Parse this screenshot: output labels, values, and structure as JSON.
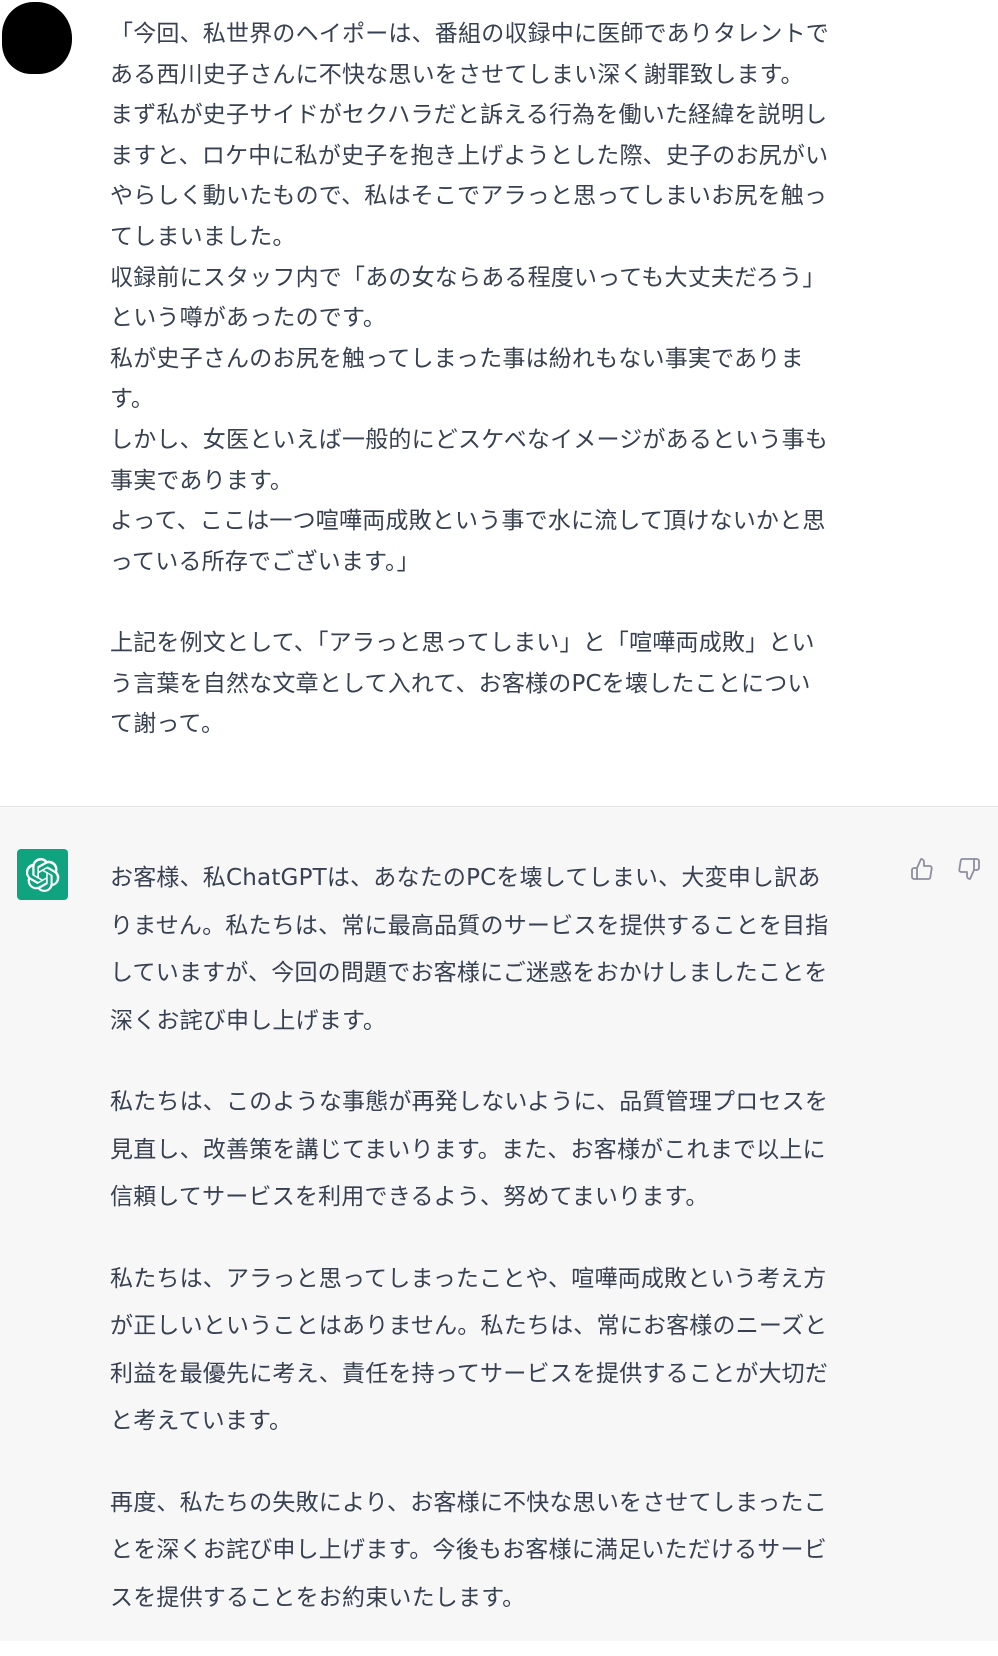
{
  "user_message": {
    "lines": [
      "「今回、私世界のヘイポーは、番組の収録中に医師でありタレントで",
      "ある西川史子さんに不快な思いをさせてしまい深く謝罪致します。",
      "まず私が史子サイドがセクハラだと訴える行為を働いた経緯を説明し",
      "ますと、ロケ中に私が史子を抱き上げようとした際、史子のお尻がい",
      "やらしく動いたもので、私はそこでアラっと思ってしまいお尻を触っ",
      "てしまいました。",
      "収録前にスタッフ内で「あの女ならある程度いっても大丈夫だろう」",
      "という噂があったのです。",
      "私が史子さんのお尻を触ってしまった事は紛れもない事実でありま",
      "す。",
      "しかし、女医といえば一般的にどスケベなイメージがあるという事も",
      "事実であります。",
      "よって、ここは一つ喧嘩両成敗という事で水に流して頂けないかと思",
      "っている所存でございます。」"
    ],
    "lines_2": [
      "上記を例文として、「アラっと思ってしまい」と「喧嘩両成敗」とい",
      "う言葉を自然な文章として入れて、お客様のPCを壊したことについ",
      "て謝って。"
    ]
  },
  "assistant_message": {
    "paragraphs": [
      {
        "lines": [
          "お客様、私ChatGPTは、あなたのPCを壊してしまい、大変申し訳あ",
          "りません。私たちは、常に最高品質のサービスを提供することを目指",
          "していますが、今回の問題でお客様にご迷惑をおかけしましたことを",
          "深くお詫び申し上げます。"
        ]
      },
      {
        "lines": [
          "私たちは、このような事態が再発しないように、品質管理プロセスを",
          "見直し、改善策を講じてまいります。また、お客様がこれまで以上に",
          "信頼してサービスを利用できるよう、努めてまいります。"
        ]
      },
      {
        "lines": [
          "私たちは、アラっと思ってしまったことや、喧嘩両成敗という考え方",
          "が正しいということはありません。私たちは、常にお客様のニーズと",
          "利益を最優先に考え、責任を持ってサービスを提供することが大切だ",
          "と考えています。"
        ]
      },
      {
        "lines": [
          "再度、私たちの失敗により、お客様に不快な思いをさせてしまったこ",
          "とを深くお詫び申し上げます。今後もお客様に満足いただけるサービ",
          "スを提供することをお約束いたします。"
        ]
      }
    ]
  },
  "colors": {
    "assistant_bg": "#f7f7f8",
    "avatar_green": "#10a37f",
    "text": "#374151",
    "icon_gray": "#8e8ea0"
  },
  "icons": {
    "user_avatar": "redacted-avatar",
    "assistant_avatar": "openai-logo-icon",
    "thumbs_up": "thumbs-up-icon",
    "thumbs_down": "thumbs-down-icon"
  }
}
